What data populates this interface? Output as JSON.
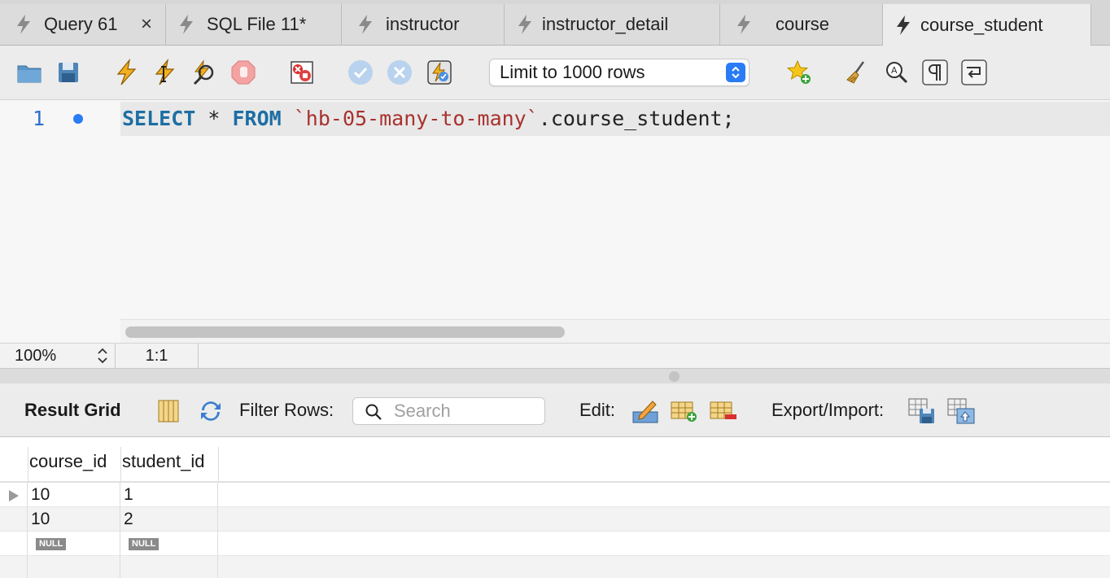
{
  "tabs": [
    {
      "label": "Query 61",
      "close": "×"
    },
    {
      "label": "SQL File 11*"
    },
    {
      "label": "instructor"
    },
    {
      "label": "instructor_detail"
    },
    {
      "label": "course"
    },
    {
      "label": "course_student"
    }
  ],
  "toolbar": {
    "limit_select": "Limit to 1000 rows"
  },
  "editor": {
    "line_number": "1",
    "code": {
      "kw_select": "SELECT",
      "star": " * ",
      "kw_from": "FROM",
      "space": " ",
      "schema": "`hb-05-many-to-many`",
      "rest": ".course_student;"
    }
  },
  "status": {
    "zoom": "100%",
    "position": "1:1"
  },
  "result": {
    "title": "Result Grid",
    "filter_label": "Filter Rows:",
    "search_placeholder": "Search",
    "edit_label": "Edit:",
    "export_label": "Export/Import:",
    "columns": [
      "course_id",
      "student_id"
    ],
    "rows": [
      [
        "10",
        "1"
      ],
      [
        "10",
        "2"
      ]
    ],
    "null_label": "NULL"
  },
  "colors": {
    "accent": "#2a7bf6",
    "keyword": "#1c6ea4",
    "string": "#a8322e",
    "bolt": "#f2b01e"
  }
}
